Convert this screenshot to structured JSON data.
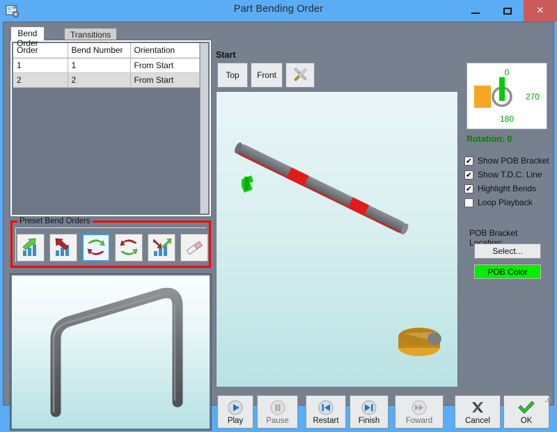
{
  "window": {
    "title": "Part Bending Order",
    "icon": "form-gear-icon",
    "controls": {
      "minimize": "–",
      "maximize": "□",
      "close": "✕"
    }
  },
  "tabs": [
    {
      "label": "Bend Order",
      "active": true
    },
    {
      "label": "Transitions",
      "active": false
    }
  ],
  "grid": {
    "columns": [
      "Order",
      "Bend Number",
      "Orientation"
    ],
    "rows": [
      {
        "order": "1",
        "bend_number": "1",
        "orientation": "From Start"
      },
      {
        "order": "2",
        "bend_number": "2",
        "orientation": "From Start"
      }
    ]
  },
  "preset_group": {
    "legend": "Preset Bend Orders",
    "highlight_color": "#ff0000",
    "buttons": [
      {
        "name": "ascending-bend-order-button",
        "icon": "green-arrow-up-bars-icon",
        "selected": false
      },
      {
        "name": "descending-bend-order-button",
        "icon": "red-arrow-down-bars-icon",
        "selected": false
      },
      {
        "name": "alternate-bend-order-button",
        "icon": "green-red-swap-arrows-icon",
        "selected": true
      },
      {
        "name": "reverse-alternate-bend-order-button",
        "icon": "red-green-swap-arrows-icon",
        "selected": false
      },
      {
        "name": "custom-bend-order-button",
        "icon": "red-green-arrows-bars-icon",
        "selected": false
      },
      {
        "name": "clear-bend-order-button",
        "icon": "eraser-icon",
        "selected": false
      }
    ]
  },
  "preview": {
    "name": "part-preview",
    "shape": "u-shaped-bent-tube"
  },
  "viewport": {
    "section_label": "Start",
    "buttons": [
      {
        "label": "Top",
        "name": "view-top-button"
      },
      {
        "label": "Front",
        "name": "view-front-button"
      },
      {
        "label": "",
        "name": "view-settings-tools-button",
        "icon": "wrench-screwdriver-icon"
      }
    ],
    "scene": "bent-tube-with-bend-die-and-pob-bracket"
  },
  "rotation": {
    "dial_labels": {
      "top": "0",
      "right": "270",
      "bottom": "180"
    },
    "status": "Rotation: 0",
    "status_color": "#0b7a0b",
    "indicator_color": "#00cc00",
    "bracket_color": "#f5a623"
  },
  "options": [
    {
      "label": "Show POB Bracket",
      "checked": true,
      "name": "checkbox-show-pob-bracket"
    },
    {
      "label": "Show T.D.C. Line",
      "checked": true,
      "name": "checkbox-show-tdc-line"
    },
    {
      "label": "Highlight Bends",
      "checked": true,
      "name": "checkbox-highlight-bends"
    },
    {
      "label": "Loop Playback",
      "checked": false,
      "name": "checkbox-loop-playback"
    }
  ],
  "pob": {
    "location_label": "POB Bracket Location:",
    "select_label": "Select...",
    "color_label": "POB Color",
    "color_value": "#00ee00"
  },
  "actions": [
    {
      "label": "Play",
      "name": "play-button",
      "icon": "play-icon",
      "enabled": true
    },
    {
      "label": "Pause",
      "name": "pause-button",
      "icon": "pause-icon",
      "enabled": false
    },
    {
      "label": "Restart",
      "name": "restart-button",
      "icon": "skip-start-icon",
      "enabled": true
    },
    {
      "label": "Finish",
      "name": "finish-button",
      "icon": "skip-end-icon",
      "enabled": true
    },
    {
      "label": "Foward",
      "name": "forward-button",
      "icon": "fast-forward-icon",
      "enabled": false
    },
    {
      "label": "Cancel",
      "name": "cancel-button",
      "icon": "x-mark-icon",
      "enabled": true
    },
    {
      "label": "OK",
      "name": "ok-button",
      "icon": "check-mark-icon",
      "enabled": true
    }
  ]
}
